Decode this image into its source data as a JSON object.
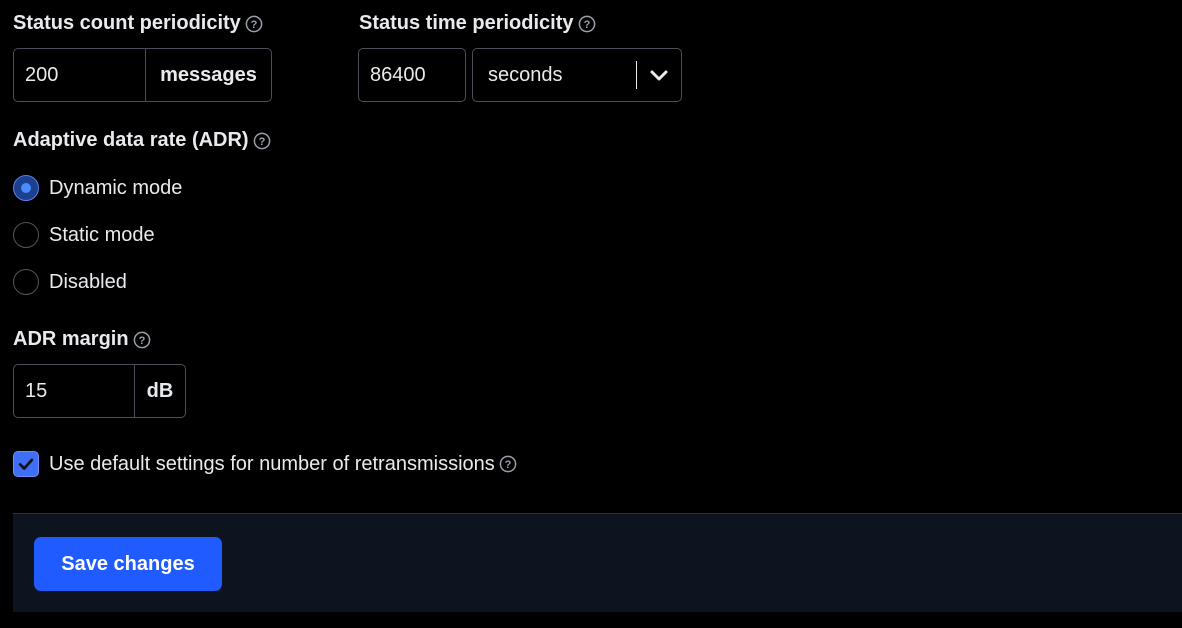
{
  "status_count": {
    "label": "Status count periodicity",
    "value": "200",
    "unit": "messages"
  },
  "status_time": {
    "label": "Status time periodicity",
    "value": "86400",
    "unit_selected": "seconds"
  },
  "adr": {
    "label": "Adaptive data rate (ADR)",
    "options": [
      {
        "label": "Dynamic mode",
        "checked": true
      },
      {
        "label": "Static mode",
        "checked": false
      },
      {
        "label": "Disabled",
        "checked": false
      }
    ]
  },
  "adr_margin": {
    "label": "ADR margin",
    "value": "15",
    "unit": "dB"
  },
  "retransmissions": {
    "label": "Use default settings for number of retransmissions",
    "checked": true
  },
  "footer": {
    "save_label": "Save changes"
  },
  "colors": {
    "background": "#000000",
    "primary": "#1f5bff",
    "border": "#4a4f57",
    "footer_bg": "#0e1320"
  },
  "icons": {
    "help": "question-circle-icon",
    "chevron": "chevron-down-icon",
    "check": "check-icon"
  }
}
